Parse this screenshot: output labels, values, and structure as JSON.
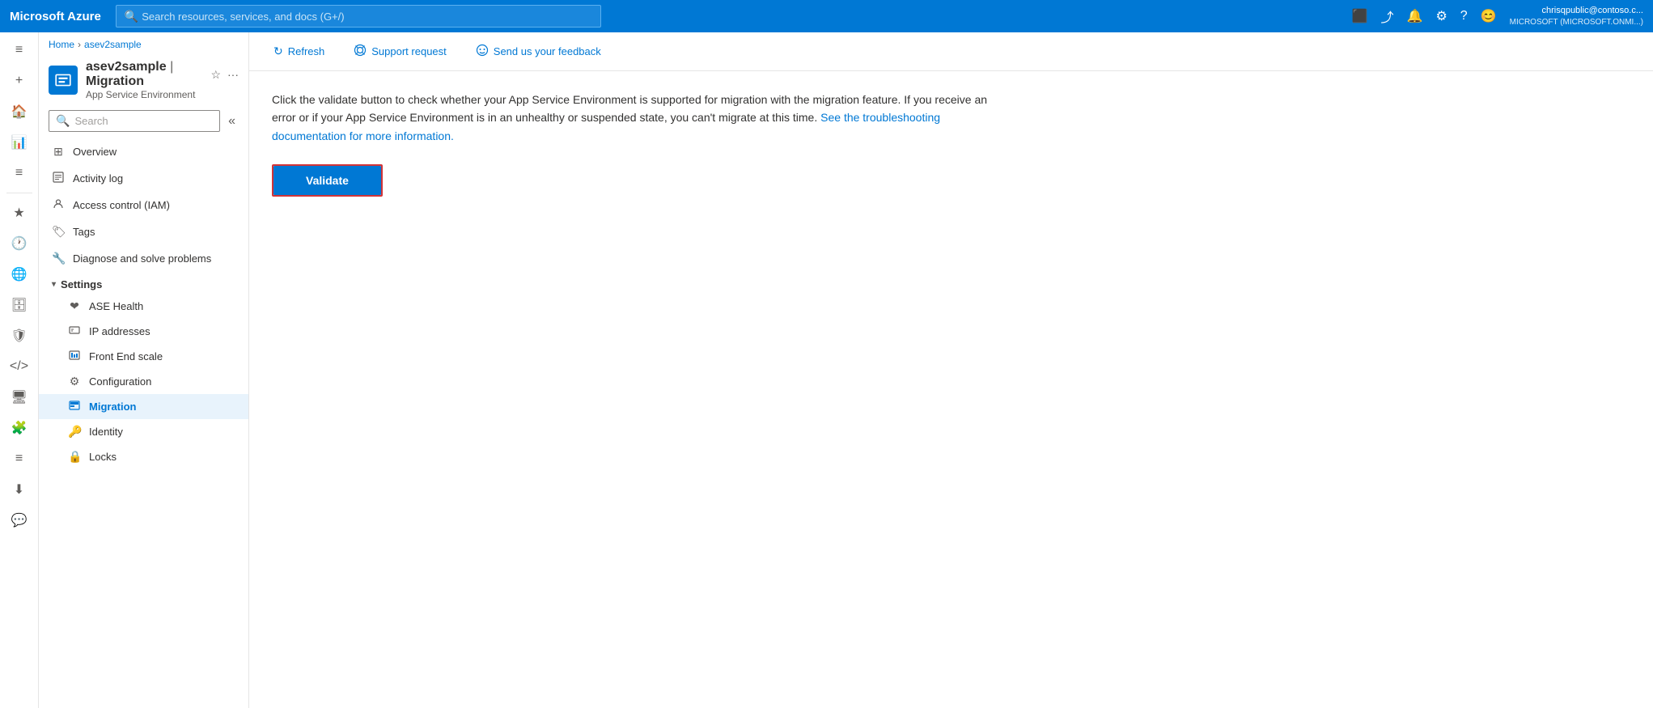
{
  "topNav": {
    "brand": "Microsoft Azure",
    "searchPlaceholder": "Search resources, services, and docs (G+/)",
    "user": {
      "name": "chrisqpublic@contoso.c...",
      "tenant": "MICROSOFT (MICROSOFT.ONMI...)"
    }
  },
  "breadcrumb": {
    "home": "Home",
    "resource": "asev2sample"
  },
  "resource": {
    "name": "asev2sample",
    "separator": "|",
    "page": "Migration",
    "subtitle": "App Service Environment"
  },
  "sidebar": {
    "searchPlaceholder": "Search",
    "navItems": [
      {
        "id": "overview",
        "label": "Overview",
        "icon": "⊞"
      },
      {
        "id": "activity-log",
        "label": "Activity log",
        "icon": "📋"
      },
      {
        "id": "access-control",
        "label": "Access control (IAM)",
        "icon": "👤"
      },
      {
        "id": "tags",
        "label": "Tags",
        "icon": "🏷"
      },
      {
        "id": "diagnose",
        "label": "Diagnose and solve problems",
        "icon": "🔧"
      }
    ],
    "settingsSection": "Settings",
    "settingsItems": [
      {
        "id": "ase-health",
        "label": "ASE Health",
        "icon": "❤"
      },
      {
        "id": "ip-addresses",
        "label": "IP addresses",
        "icon": "🖥"
      },
      {
        "id": "front-end-scale",
        "label": "Front End scale",
        "icon": "📊"
      },
      {
        "id": "configuration",
        "label": "Configuration",
        "icon": "⚙"
      },
      {
        "id": "migration",
        "label": "Migration",
        "icon": "📦",
        "active": true
      },
      {
        "id": "identity",
        "label": "Identity",
        "icon": "🔑"
      },
      {
        "id": "locks",
        "label": "Locks",
        "icon": "🔒"
      }
    ]
  },
  "toolbar": {
    "refreshLabel": "Refresh",
    "supportLabel": "Support request",
    "feedbackLabel": "Send us your feedback"
  },
  "mainContent": {
    "description": "Click the validate button to check whether your App Service Environment is supported for migration with the migration feature. If you receive an error or if your App Service Environment is in an unhealthy or suspended state, you can't migrate at this time.",
    "linkText": "See the troubleshooting documentation for more information.",
    "validateLabel": "Validate"
  }
}
